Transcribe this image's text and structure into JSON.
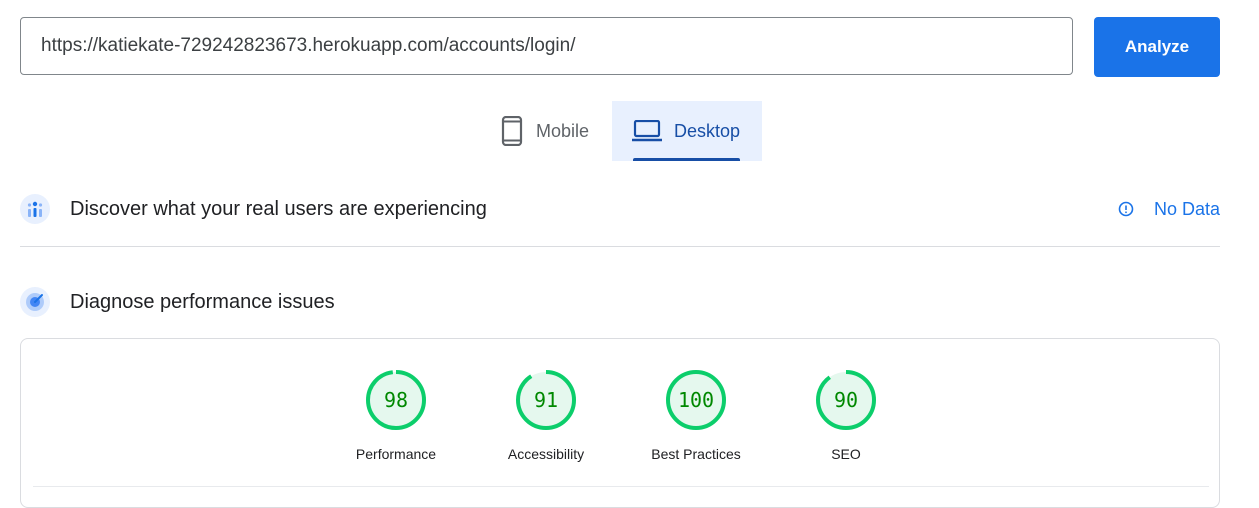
{
  "url_input": {
    "value": "https://katiekate-729242823673.herokuapp.com/accounts/login/"
  },
  "analyze_button": {
    "label": "Analyze"
  },
  "device_tabs": [
    {
      "label": "Mobile",
      "icon": "smartphone-icon",
      "selected": false
    },
    {
      "label": "Desktop",
      "icon": "laptop-icon",
      "selected": true
    }
  ],
  "field_data": {
    "title": "Discover what your real users are experiencing",
    "status": "No Data",
    "icon": "users-chart-icon",
    "status_icon": "info-icon"
  },
  "lab_data": {
    "title": "Diagnose performance issues",
    "icon": "gauge-icon"
  },
  "scores": [
    {
      "label": "Performance",
      "value": "98"
    },
    {
      "label": "Accessibility",
      "value": "91"
    },
    {
      "label": "Best Practices",
      "value": "100"
    },
    {
      "label": "SEO",
      "value": "90"
    }
  ],
  "colors": {
    "accent": "#1a73e8",
    "pass": "#0cce6b",
    "pass_text": "#008800",
    "pass_bg": "#e5f8ee"
  }
}
